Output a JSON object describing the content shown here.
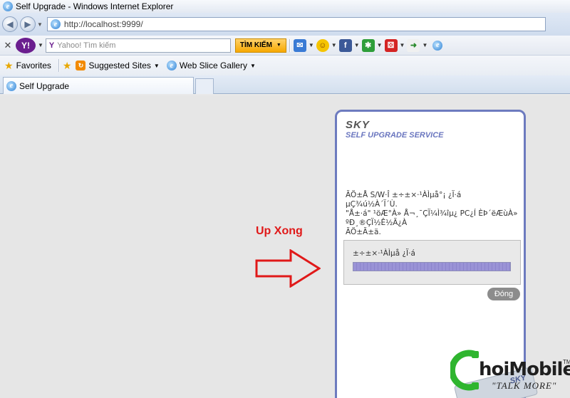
{
  "window": {
    "title": "Self Upgrade - Windows Internet Explorer"
  },
  "address": {
    "url": "http://localhost:9999/"
  },
  "yahoo_toolbar": {
    "search_placeholder": "Yahoo! Tìm kiếm",
    "search_button": "TÌM KIẾM"
  },
  "favorites_bar": {
    "favorites": "Favorites",
    "suggested": "Suggested Sites",
    "webslice": "Web Slice Gallery"
  },
  "tab": {
    "label": "Self Upgrade"
  },
  "panel": {
    "brand": "SKY",
    "service": "SELF UPGRADE SERVICE",
    "message": [
      "ÃÖ±Å S/W·Î ±÷±×·¹ÀÌµå°¡ ¿Ï·á",
      "µÇ¾ú½À´Ï´Ù.",
      "\"Å±·á\" ¹öÆ°À» Å¬¸¯ÇÏ¼Ì¾îµ¿ PC¿Í ÈÞ´ëÆùÀ»",
      "ºÐ¸®ÇÏ½Ê½Ã¿À",
      "ÃÖ±Ã±ä."
    ],
    "progress_label": "±÷±×·¹ÀÌµå ¿Ï·á",
    "progress_fraction": 1.0,
    "close_button": "Đóng"
  },
  "annotation": {
    "text": "Up Xong",
    "color": "#e01919"
  },
  "watermark": {
    "brand": "hoiMobile",
    "tagline": "\"TALK MORE\"",
    "tm": "TM",
    "card": "SKY"
  }
}
